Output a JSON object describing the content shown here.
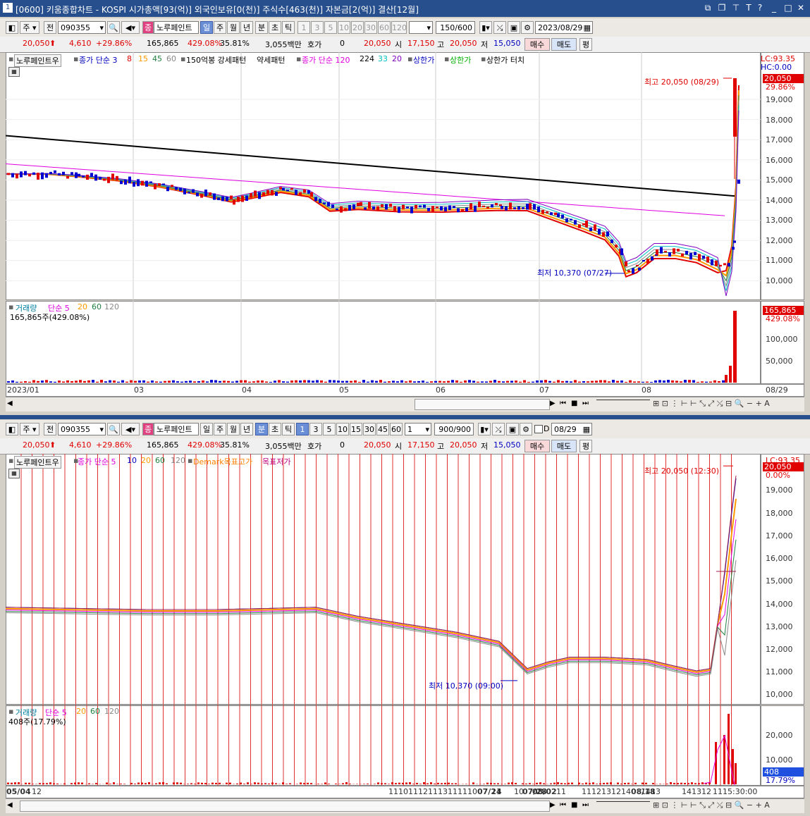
{
  "window": {
    "number": "1",
    "title": "[0600] 키움종합차트 - KOSPI 시가총액[93(억)] 외국인보유[0(천)] 주식수[463(천)] 자본금[2(억)] 결산[12월]"
  },
  "top": {
    "toolbar": {
      "type": "주",
      "prev": "전",
      "code": "090355",
      "name": "노루페인트",
      "periods": [
        "일",
        "주",
        "월",
        "년",
        "분",
        "초",
        "틱"
      ],
      "minutes": [
        "1",
        "3",
        "5",
        "10",
        "20",
        "30",
        "60",
        "120"
      ],
      "count": "150/600",
      "date": "2023/08/29"
    },
    "info": {
      "price": "20,050",
      "change": "4,610",
      "change_pct": "+29.86%",
      "volume": "165,865",
      "vol_ratio": "429.08%",
      "turnover": "35.81%",
      "amount": "3,055백만",
      "hoga_label": "호가",
      "hoga": "0",
      "cur": "20,050",
      "open_label": "시",
      "open": "17,150",
      "high_label": "고",
      "high": "20,050",
      "low_label": "저",
      "low": "15,050",
      "buy": "매수",
      "sell": "매도",
      "avg": "평"
    },
    "legend": {
      "name": "노루페인트우",
      "ma": "종가 단순 3",
      "ma_vals": [
        "8",
        "15",
        "45",
        "60"
      ],
      "pattern1": "150억봉 강세패턴",
      "pattern2": "약세패턴",
      "ma2": "종가 단순 120",
      "ma2_vals": [
        "224",
        "33",
        "20"
      ],
      "limit1": "상한가",
      "limit2": "상한가",
      "limit3": "상한가 터치"
    },
    "right_tags": {
      "lc": "LC:93.35",
      "hc": "HC:0.00",
      "price": "20,050",
      "pct": "29.86%"
    },
    "annot_high": "최고 20,050 (08/29)",
    "annot_low": "최저 10,370 (07/27)",
    "price_ticks": [
      "19,000",
      "18,000",
      "17,000",
      "16,000",
      "15,000",
      "14,000",
      "13,000",
      "12,000",
      "11,000",
      "10,000"
    ],
    "vol_legend": {
      "name": "거래량",
      "ma": "단순 5",
      "vals": [
        "20",
        "60",
        "120"
      ],
      "value": "165,865주(429.08%)"
    },
    "vol_tags": {
      "value": "165,865",
      "pct": "429.08%"
    },
    "vol_ticks": [
      "100,000",
      "50,000"
    ],
    "x_ticks": [
      "2023/01",
      "03",
      "04",
      "05",
      "06",
      "07",
      "08",
      "08/29"
    ]
  },
  "bottom": {
    "toolbar": {
      "type": "주",
      "prev": "전",
      "code": "090355",
      "name": "노루페인트",
      "periods": [
        "일",
        "주",
        "월",
        "년",
        "분",
        "초",
        "틱"
      ],
      "minutes": [
        "1",
        "3",
        "5",
        "10",
        "15",
        "30",
        "45",
        "60"
      ],
      "sel_min": "1",
      "count": "900/900",
      "d_label": "D",
      "date": "08/29"
    },
    "info": {
      "price": "20,050",
      "change": "4,610",
      "change_pct": "+29.86%",
      "volume": "165,865",
      "vol_ratio": "429.08%",
      "turnover": "35.81%",
      "amount": "3,055백만",
      "hoga_label": "호가",
      "hoga": "0",
      "cur": "20,050",
      "open_label": "시",
      "open": "17,150",
      "high_label": "고",
      "high": "20,050",
      "low_label": "저",
      "low": "15,050",
      "buy": "매수",
      "sell": "매도",
      "avg": "평"
    },
    "legend": {
      "name": "노루페인트우",
      "ma": "종가 단순 5",
      "ma_vals": [
        "10",
        "20",
        "60",
        "120"
      ],
      "demark": "Demark목표고가",
      "demark2": "목표저가"
    },
    "right_tags": {
      "lc": "LC:93.35",
      "hc": "HC:0.00",
      "price": "20,050",
      "pct": "0.00%"
    },
    "annot_high": "최고 20,050 (12:30)",
    "annot_low": "최저 10,370 (09:00)",
    "price_ticks": [
      "19,000",
      "18,000",
      "17,000",
      "16,000",
      "15,000",
      "14,000",
      "13,000",
      "12,000",
      "11,000",
      "10,000"
    ],
    "vol_legend": {
      "name": "거래량",
      "ma": "단순 5",
      "vals": [
        "20",
        "60",
        "120"
      ],
      "value": "408주(17.79%)"
    },
    "vol_tags": {
      "value": "408",
      "pct": "17.79%"
    },
    "vol_ticks": [
      "20,000",
      "10,000"
    ],
    "x_ticks": [
      "05/04",
      "12",
      "11",
      "10",
      "11",
      "12",
      "11",
      "13",
      "11",
      "11",
      "10",
      "07/24",
      "11",
      "10",
      "07/28",
      "08/02",
      "11",
      "11",
      "12",
      "13",
      "12",
      "14",
      "08/18",
      "14",
      "13",
      "14",
      "13",
      "12",
      "11",
      "15:30:00"
    ]
  },
  "colors": {
    "up": "#e00000",
    "down": "#0000d0",
    "accent": "#274f8d"
  }
}
